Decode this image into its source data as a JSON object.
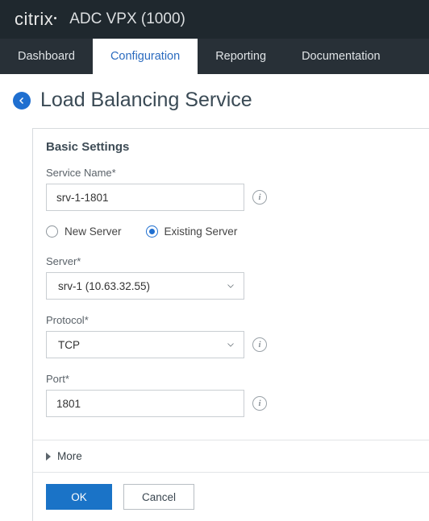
{
  "brand": {
    "vendor": "citrix",
    "product": "ADC VPX (1000)"
  },
  "tabs": {
    "dashboard": "Dashboard",
    "configuration": "Configuration",
    "reporting": "Reporting",
    "documentation": "Documentation"
  },
  "page": {
    "title": "Load Balancing Service"
  },
  "panel": {
    "title": "Basic Settings",
    "service_name": {
      "label": "Service Name*",
      "value": "srv-1-1801"
    },
    "server_mode": {
      "new_label": "New Server",
      "existing_label": "Existing Server",
      "selected": "existing"
    },
    "server": {
      "label": "Server*",
      "value": "srv-1 (10.63.32.55)"
    },
    "protocol": {
      "label": "Protocol*",
      "value": "TCP"
    },
    "port": {
      "label": "Port*",
      "value": "1801"
    },
    "more_label": "More"
  },
  "buttons": {
    "ok": "OK",
    "cancel": "Cancel"
  }
}
